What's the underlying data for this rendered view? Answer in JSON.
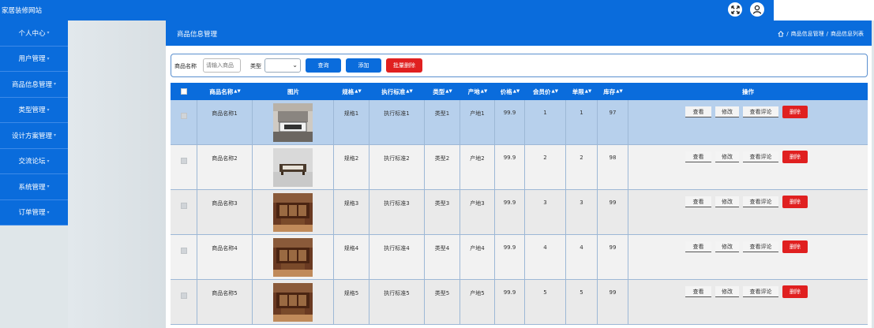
{
  "app": {
    "title": "家居装修网站"
  },
  "colors": {
    "primary": "#0a6cdc",
    "danger": "#e02020"
  },
  "sidebar": {
    "items": [
      {
        "label": "个人中心"
      },
      {
        "label": "用户管理"
      },
      {
        "label": "商品信息管理"
      },
      {
        "label": "类型管理"
      },
      {
        "label": "设计方案管理"
      },
      {
        "label": "交流论坛"
      },
      {
        "label": "系统管理"
      },
      {
        "label": "订单管理"
      }
    ]
  },
  "header": {
    "title": "商品信息管理",
    "breadcrumb": [
      "商品信息管理",
      "商品信息列表"
    ]
  },
  "search": {
    "name_label": "商品名称",
    "name_placeholder": "请输入商品",
    "type_label": "类型",
    "query_label": "查询",
    "add_label": "添加",
    "batch_delete_label": "批量删除"
  },
  "table": {
    "columns": [
      "商品名称",
      "图片",
      "规格",
      "执行标准",
      "类型",
      "产地",
      "价格",
      "会员价",
      "单限",
      "库存",
      "操作"
    ],
    "actions": {
      "view": "查看",
      "edit": "修改",
      "comments": "查看评论",
      "delete": "删除"
    },
    "rows": [
      {
        "name": "商品名称1",
        "spec": "规格1",
        "standard": "执行标准1",
        "type": "类型1",
        "origin": "产地1",
        "price": "99.9",
        "member_price": "1",
        "limit": "1",
        "stock": "97"
      },
      {
        "name": "商品名称2",
        "spec": "规格2",
        "standard": "执行标准2",
        "type": "类型2",
        "origin": "产地2",
        "price": "99.9",
        "member_price": "2",
        "limit": "2",
        "stock": "98"
      },
      {
        "name": "商品名称3",
        "spec": "规格3",
        "standard": "执行标准3",
        "type": "类型3",
        "origin": "产地3",
        "price": "99.9",
        "member_price": "3",
        "limit": "3",
        "stock": "99"
      },
      {
        "name": "商品名称4",
        "spec": "规格4",
        "standard": "执行标准4",
        "type": "类型4",
        "origin": "产地4",
        "price": "99.9",
        "member_price": "4",
        "limit": "4",
        "stock": "99"
      },
      {
        "name": "商品名称5",
        "spec": "规格5",
        "standard": "执行标准5",
        "type": "类型5",
        "origin": "产地5",
        "price": "99.9",
        "member_price": "5",
        "limit": "5",
        "stock": "99"
      }
    ]
  }
}
